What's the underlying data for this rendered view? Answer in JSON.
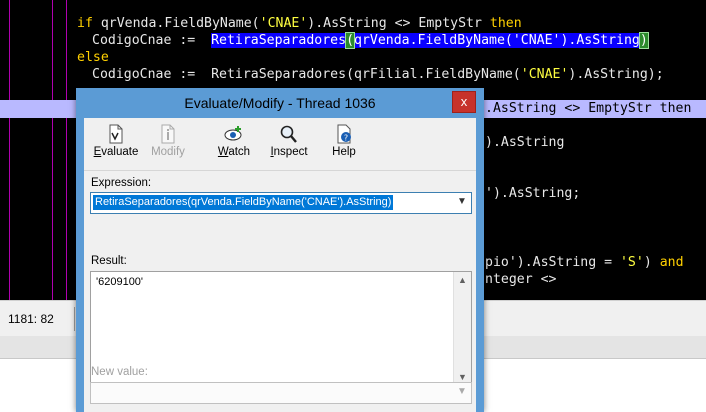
{
  "editor": {
    "line1": {
      "kw_if": "if",
      "a": " qrVenda.FieldByName(",
      "s": "'CNAE'",
      "b": ").AsString <> EmptyStr ",
      "kw_then": "then"
    },
    "line2": {
      "a": "CodigoCnae :=  ",
      "sel1": "RetiraSeparadores",
      "paren": "(",
      "sel2": "qrVenda.FieldByName('CNAE').AsString",
      "close": ")"
    },
    "line3": {
      "kw": "else"
    },
    "line4": {
      "a": "CodigoCnae :=  RetiraSeparadores(qrFilial.FieldByName(",
      "s": "'CNAE'",
      "b": ").AsString);"
    },
    "band": ".AsString <> EmptyStr then",
    "frag1": ").AsString",
    "frag2": "').AsString;",
    "frag3a": "pio').AsString = ",
    "frag3s": "'S'",
    "frag3b": ") ",
    "frag3kw": "and",
    "frag4": "nteger <>"
  },
  "status": {
    "position": "1181: 82"
  },
  "dialog": {
    "title": "Evaluate/Modify - Thread 1036",
    "close_glyph": "x",
    "toolbar": {
      "evaluate": "Evaluate",
      "modify": "Modify",
      "watch": "Watch",
      "inspect": "Inspect",
      "help": "Help"
    },
    "expression_label": "Expression:",
    "expression_value": "RetiraSeparadores(qrVenda.FieldByName('CNAE').AsString)",
    "result_label": "Result:",
    "result_value": "'6209100'",
    "new_value_label": "New value:",
    "new_value_value": ""
  }
}
